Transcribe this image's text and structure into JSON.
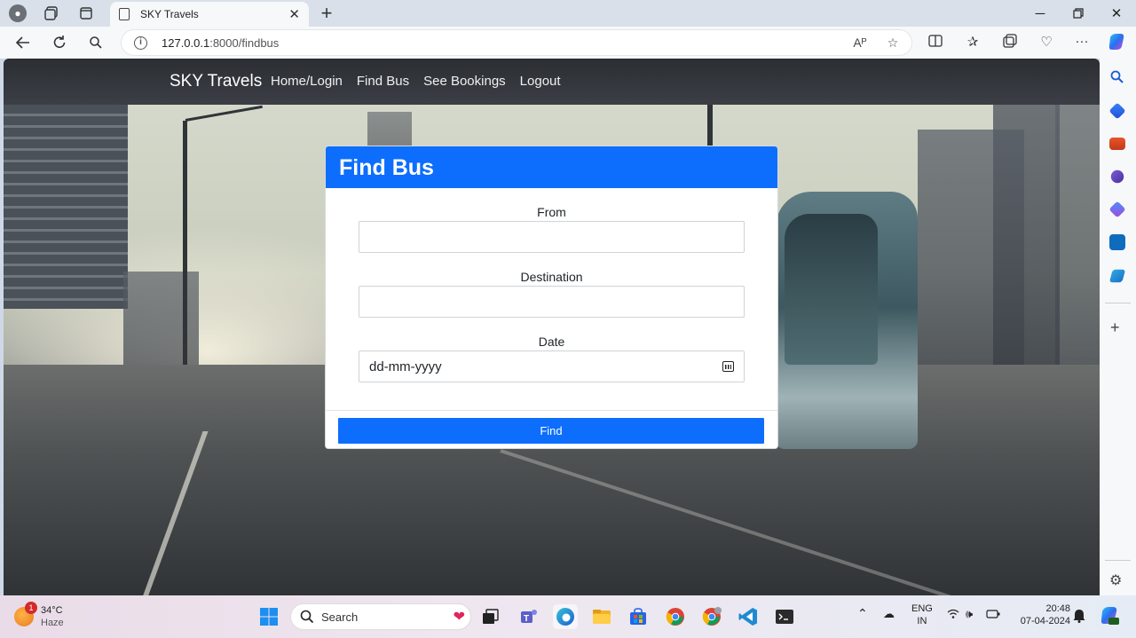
{
  "browser": {
    "tab_title": "SKY Travels",
    "url_host": "127.0.0.1",
    "url_path": ":8000/findbus",
    "read_aloud_label": "Aᴾ"
  },
  "navbar": {
    "brand": "SKY Travels",
    "links": [
      "Home/Login",
      "Find Bus",
      "See Bookings",
      "Logout"
    ]
  },
  "form": {
    "title": "Find Bus",
    "from_label": "From",
    "from_value": "",
    "destination_label": "Destination",
    "destination_value": "",
    "date_label": "Date",
    "date_placeholder": "dd-mm-yyyy",
    "submit_label": "Find"
  },
  "taskbar": {
    "weather_temp": "34°C",
    "weather_desc": "Haze",
    "weather_badge": "1",
    "search_label": "Search",
    "lang_top": "ENG",
    "lang_bottom": "IN",
    "time": "20:48",
    "date": "07-04-2024"
  },
  "colors": {
    "primary": "#0d6efd",
    "navbar": "#343a40"
  }
}
